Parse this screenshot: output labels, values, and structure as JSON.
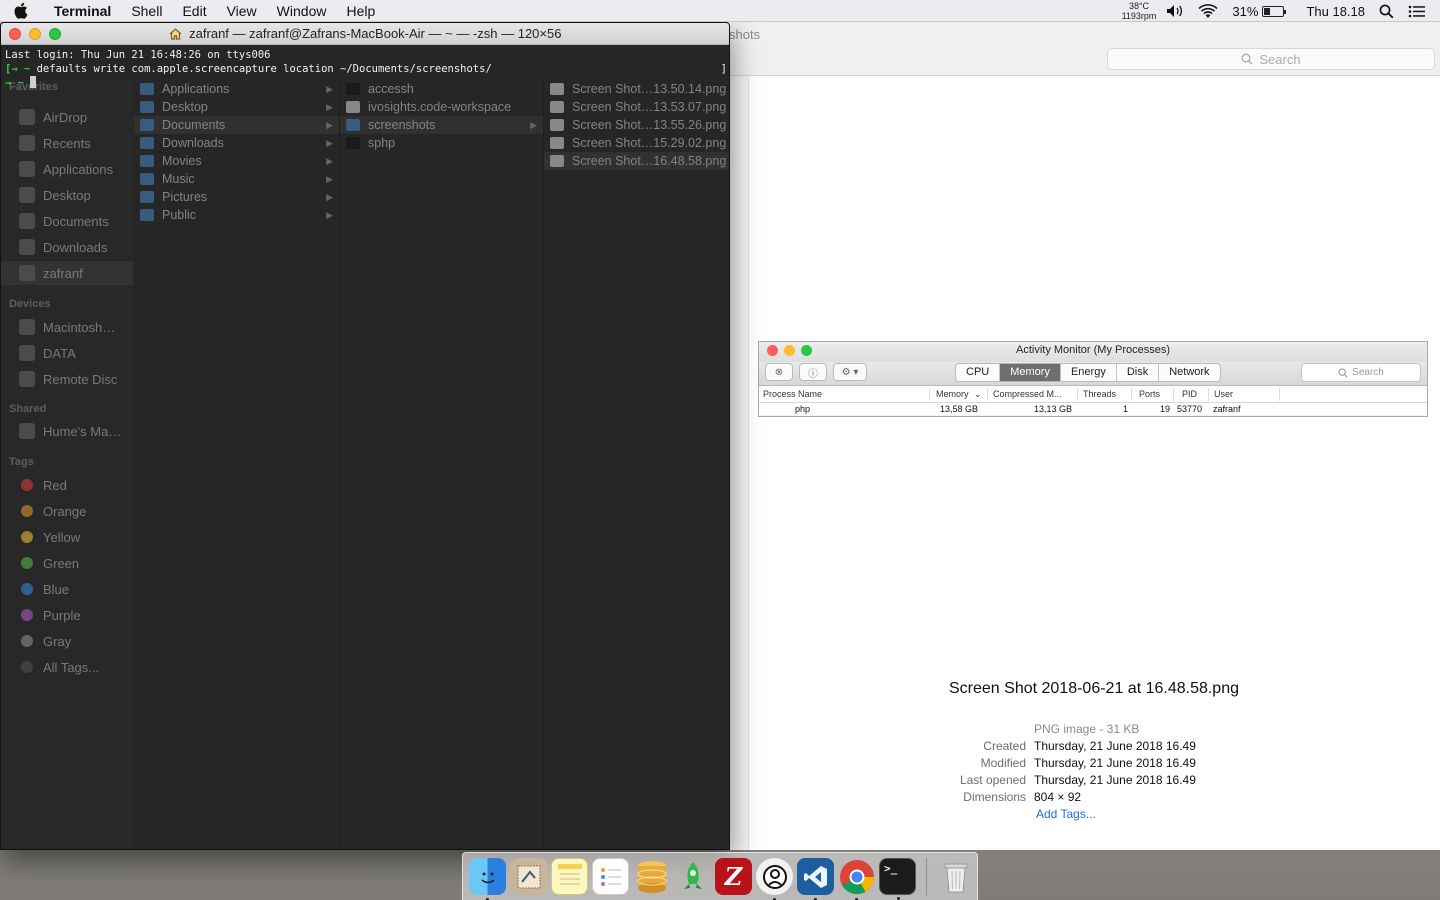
{
  "menubar": {
    "app_name": "Terminal",
    "items": [
      "Shell",
      "Edit",
      "View",
      "Window",
      "Help"
    ],
    "temp": "38°C",
    "rpm": "1193rpm",
    "battery": "31%",
    "battery_level": 0.31,
    "clock": "Thu 18.18"
  },
  "finder": {
    "title_partial": "shots",
    "search_placeholder": "Search"
  },
  "terminal": {
    "title": "zafranf — zafranf@Zafrans-MacBook-Air — ~ — -zsh — 120×56",
    "lines": {
      "line1": "Last login: Thu Jun 21 16:48:26 on ttys006",
      "line2_prefix": "[→ ~ ",
      "line2_cmd": "defaults write com.apple.screencapture location ~/Documents/screenshots/",
      "line2_suffix": "]",
      "line3_prefix": "→ ~ "
    }
  },
  "ghost_finder": {
    "sidebar": {
      "favorites_label": "Favorites",
      "favorites": [
        "AirDrop",
        "Recents",
        "Applications",
        "Desktop",
        "Documents",
        "Downloads",
        "zafranf"
      ],
      "devices_label": "Devices",
      "devices": [
        "Macintosh…",
        "DATA",
        "Remote Disc"
      ],
      "shared_label": "Shared",
      "shared": [
        "Hume's Ma…"
      ],
      "tags_label": "Tags",
      "tags": [
        {
          "name": "Red",
          "color": "#e0443e"
        },
        {
          "name": "Orange",
          "color": "#f39a2b"
        },
        {
          "name": "Yellow",
          "color": "#f5cc35"
        },
        {
          "name": "Green",
          "color": "#5ac150"
        },
        {
          "name": "Blue",
          "color": "#3b8ef0"
        },
        {
          "name": "Purple",
          "color": "#b066d6"
        },
        {
          "name": "Gray",
          "color": "#9a9a9a"
        }
      ],
      "all_tags": "All Tags..."
    },
    "col1": [
      "Applications",
      "Desktop",
      "Documents",
      "Downloads",
      "Movies",
      "Music",
      "Pictures",
      "Public"
    ],
    "col2": [
      "accessh",
      "ivosights.code-workspace",
      "screenshots",
      "sphp"
    ],
    "col3": [
      "Screen Shot…13.50.14.png",
      "Screen Shot…13.53.07.png",
      "Screen Shot…13.55.26.png",
      "Screen Shot…15.29.02.png",
      "Screen Shot…16.48.58.png"
    ]
  },
  "preview": {
    "title": "Activity Monitor (My Processes)",
    "tabs": [
      "CPU",
      "Memory",
      "Energy",
      "Disk",
      "Network"
    ],
    "active_tab": "Memory",
    "search": "Search",
    "columns": [
      "Process Name",
      "Memory",
      "Compressed M...",
      "Threads",
      "Ports",
      "PID",
      "User"
    ],
    "row": {
      "name": "php",
      "memory": "13,58 GB",
      "compressed": "13,13 GB",
      "threads": "1",
      "ports": "19",
      "pid": "53770",
      "user": "zafranf"
    }
  },
  "file_info": {
    "filename": "Screen Shot 2018-06-21 at 16.48.58.png",
    "kind": "PNG image - 31 KB",
    "created_label": "Created",
    "created": "Thursday, 21 June 2018 16.49",
    "modified_label": "Modified",
    "modified": "Thursday, 21 June 2018 16.49",
    "last_opened_label": "Last opened",
    "last_opened": "Thursday, 21 June 2018 16.49",
    "dimensions_label": "Dimensions",
    "dimensions": "804 × 92",
    "add_tags": "Add Tags..."
  },
  "dock": {
    "apps": [
      "Finder",
      "Mail Preview",
      "Notes",
      "Reminders",
      "Sequel Pro",
      "Rocket",
      "FileZilla",
      "Clock",
      "VS Code",
      "Chrome",
      "Terminal",
      "Trash"
    ],
    "filezilla_glyph": "Z",
    "terminal_glyph": ">_"
  }
}
